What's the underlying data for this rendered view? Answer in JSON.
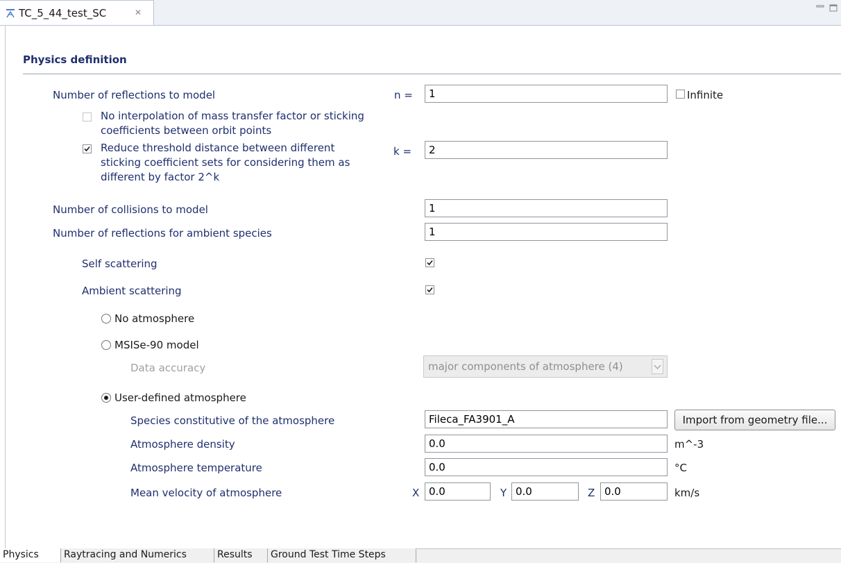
{
  "editor": {
    "tab_title": "TC_5_44_test_SC",
    "close_glyph": "✕"
  },
  "section": {
    "title": "Physics definition"
  },
  "reflections": {
    "label": "Number of reflections to model",
    "n_prefix": "n =",
    "value": "1",
    "infinite_label": "Infinite",
    "infinite_checked": false,
    "no_interp_label": "No interpolation of mass transfer factor or sticking coefficients between orbit points",
    "no_interp_checked": false,
    "reduce_label": "Reduce threshold distance between different sticking coefficient sets for considering them as different by factor 2^k",
    "reduce_checked": true,
    "k_prefix": "k =",
    "k_value": "2"
  },
  "collisions": {
    "label": "Number of collisions to model",
    "value": "1"
  },
  "ambient_reflections": {
    "label": "Number of reflections for ambient species",
    "value": "1"
  },
  "self_scattering": {
    "label": "Self scattering",
    "checked": true
  },
  "ambient_scattering": {
    "label": "Ambient scattering",
    "checked": true
  },
  "atmosphere": {
    "no_atmosphere_label": "No atmosphere",
    "msise_label": "MSISe-90 model",
    "data_accuracy_label": "Data accuracy",
    "data_accuracy_value": "major components of atmosphere (4)",
    "user_defined_label": "User-defined atmosphere",
    "selected": "User-defined atmosphere",
    "species_label": "Species constitutive of the atmosphere",
    "species_value": "Fileca_FA3901_A",
    "import_button": "Import from geometry file...",
    "density_label": "Atmosphere density",
    "density_value": "0.0",
    "density_unit": "m^-3",
    "temperature_label": "Atmosphere temperature",
    "temperature_value": "0.0",
    "temperature_unit": "°C",
    "velocity_label": "Mean velocity of atmosphere",
    "x_label": "X",
    "x_value": "0.0",
    "y_label": "Y",
    "y_value": "0.0",
    "z_label": "Z",
    "z_value": "0.0",
    "velocity_unit": "km/s"
  },
  "bottom_tabs": [
    {
      "label": "Physics",
      "active": true
    },
    {
      "label": "Raytracing and Numerics",
      "active": false
    },
    {
      "label": "Results",
      "active": false
    },
    {
      "label": "Ground Test Time Steps",
      "active": false
    }
  ],
  "colors": {
    "label_blue": "#1f2f6e",
    "accent": "#1f2f6e"
  },
  "icons": [
    "editor-file-icon",
    "close-icon",
    "minimize-icon",
    "maximize-icon",
    "check-icon"
  ]
}
